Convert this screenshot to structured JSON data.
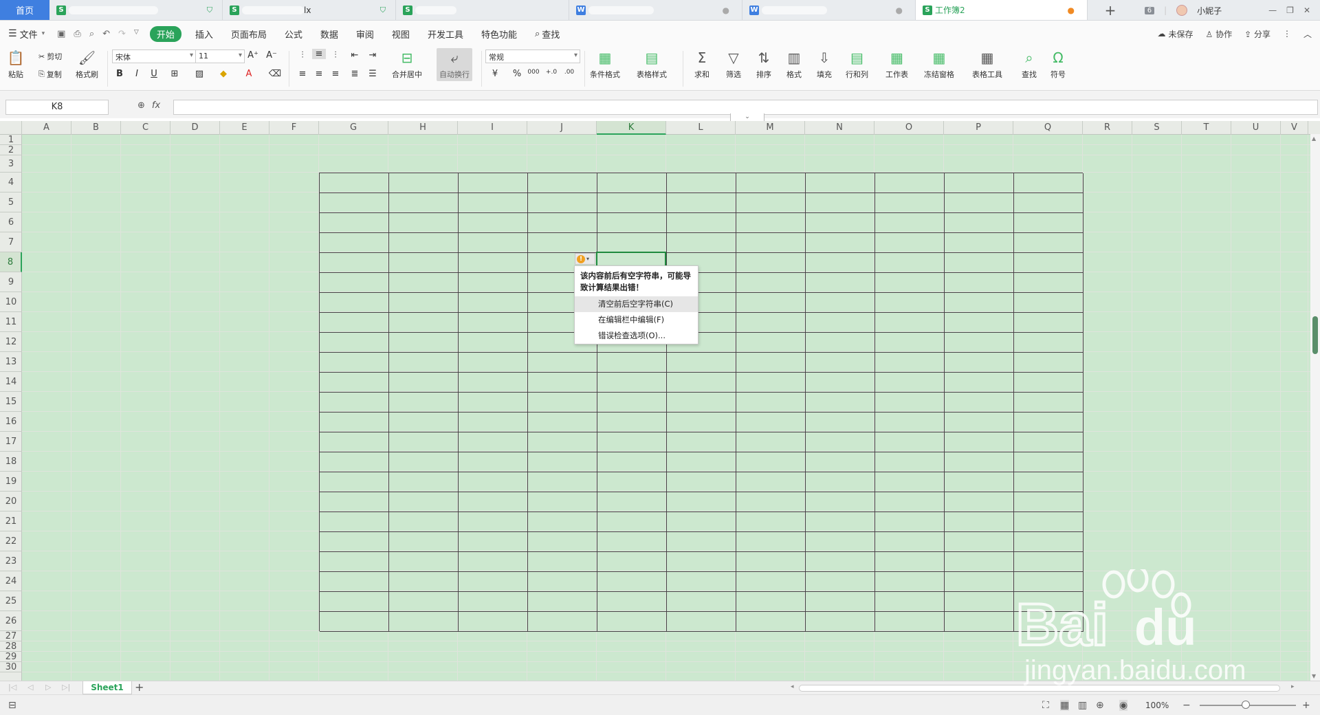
{
  "tabs": {
    "home": "首页",
    "docs": [
      {
        "type": "s",
        "title": "",
        "status": "shield"
      },
      {
        "type": "s",
        "title": "lx",
        "status": "shield"
      },
      {
        "type": "s",
        "title": "",
        "status": ""
      },
      {
        "type": "w",
        "title": "",
        "status": "dot"
      },
      {
        "type": "w",
        "title": "",
        "status": "dot"
      },
      {
        "type": "s",
        "title": "工作簿2",
        "status": "dot"
      }
    ],
    "window_count": "6",
    "user_name": "小妮子"
  },
  "menu": {
    "file": "文件",
    "items": [
      "开始",
      "插入",
      "页面布局",
      "公式",
      "数据",
      "审阅",
      "视图",
      "开发工具",
      "特色功能"
    ],
    "search": "查找",
    "unsaved": "未保存",
    "collaborate": "协作",
    "share": "分享"
  },
  "ribbon": {
    "paste": "粘贴",
    "cut": "剪切",
    "copy": "复制",
    "format_painter": "格式刷",
    "font_name": "宋体",
    "font_size": "11",
    "merge_center": "合并居中",
    "wrap_text": "自动换行",
    "number_format": "常规",
    "conditional_format": "条件格式",
    "table_style": "表格样式",
    "sum": "求和",
    "filter": "筛选",
    "sort": "排序",
    "format": "格式",
    "fill": "填充",
    "row_col": "行和列",
    "worksheet": "工作表",
    "freeze": "冻结窗格",
    "table_tools": "表格工具",
    "find": "查找",
    "symbol": "符号"
  },
  "formula_bar": {
    "name_box": "K8",
    "fx": "fx",
    "content": ""
  },
  "columns": [
    "A",
    "B",
    "C",
    "D",
    "E",
    "F",
    "G",
    "H",
    "I",
    "J",
    "K",
    "L",
    "M",
    "N",
    "O",
    "P",
    "Q",
    "R",
    "S",
    "T",
    "U",
    "V"
  ],
  "rows": [
    "1",
    "2",
    "3",
    "4",
    "5",
    "6",
    "7",
    "8",
    "9",
    "10",
    "11",
    "12",
    "13",
    "14",
    "15",
    "16",
    "17",
    "18",
    "19",
    "20",
    "21",
    "22",
    "23",
    "24",
    "25",
    "26",
    "27",
    "28",
    "29",
    "30"
  ],
  "active_cell": "K8",
  "error_popup": {
    "message": "该内容前后有空字符串，可能导致计算结果出错！",
    "items": [
      "清空前后空字符串(C)",
      "在编辑栏中编辑(F)",
      "错误检查选项(O)..."
    ]
  },
  "sheet_tabs": [
    "Sheet1"
  ],
  "status": {
    "zoom": "100%"
  },
  "colors": {
    "accent": "#2aa35a",
    "sheet_bg": "#cce8cf",
    "home_tab": "#3f7fe0"
  }
}
